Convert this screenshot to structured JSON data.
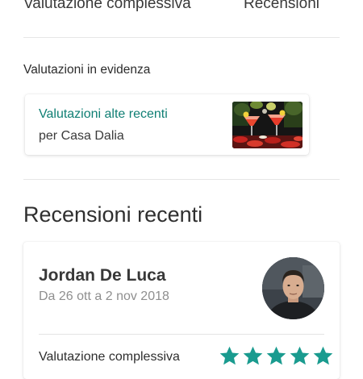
{
  "summary": {
    "overall_rating_label": "Valutazione complessiva",
    "reviews_label": "Recensioni"
  },
  "highlights": {
    "title": "Valutazioni in evidenza",
    "card_title": "Valutazioni alte recenti",
    "card_subtitle": "per Casa Dalia"
  },
  "recent_reviews": {
    "title": "Recensioni recenti",
    "items": [
      {
        "name": "Jordan De Luca",
        "dates": "Da 26 ott a 2 nov 2018",
        "overall_label": "Valutazione complessiva",
        "rating": 5,
        "rating_max": 5
      }
    ]
  },
  "colors": {
    "accent": "#0f7f74",
    "star": "#1a9b8f"
  }
}
